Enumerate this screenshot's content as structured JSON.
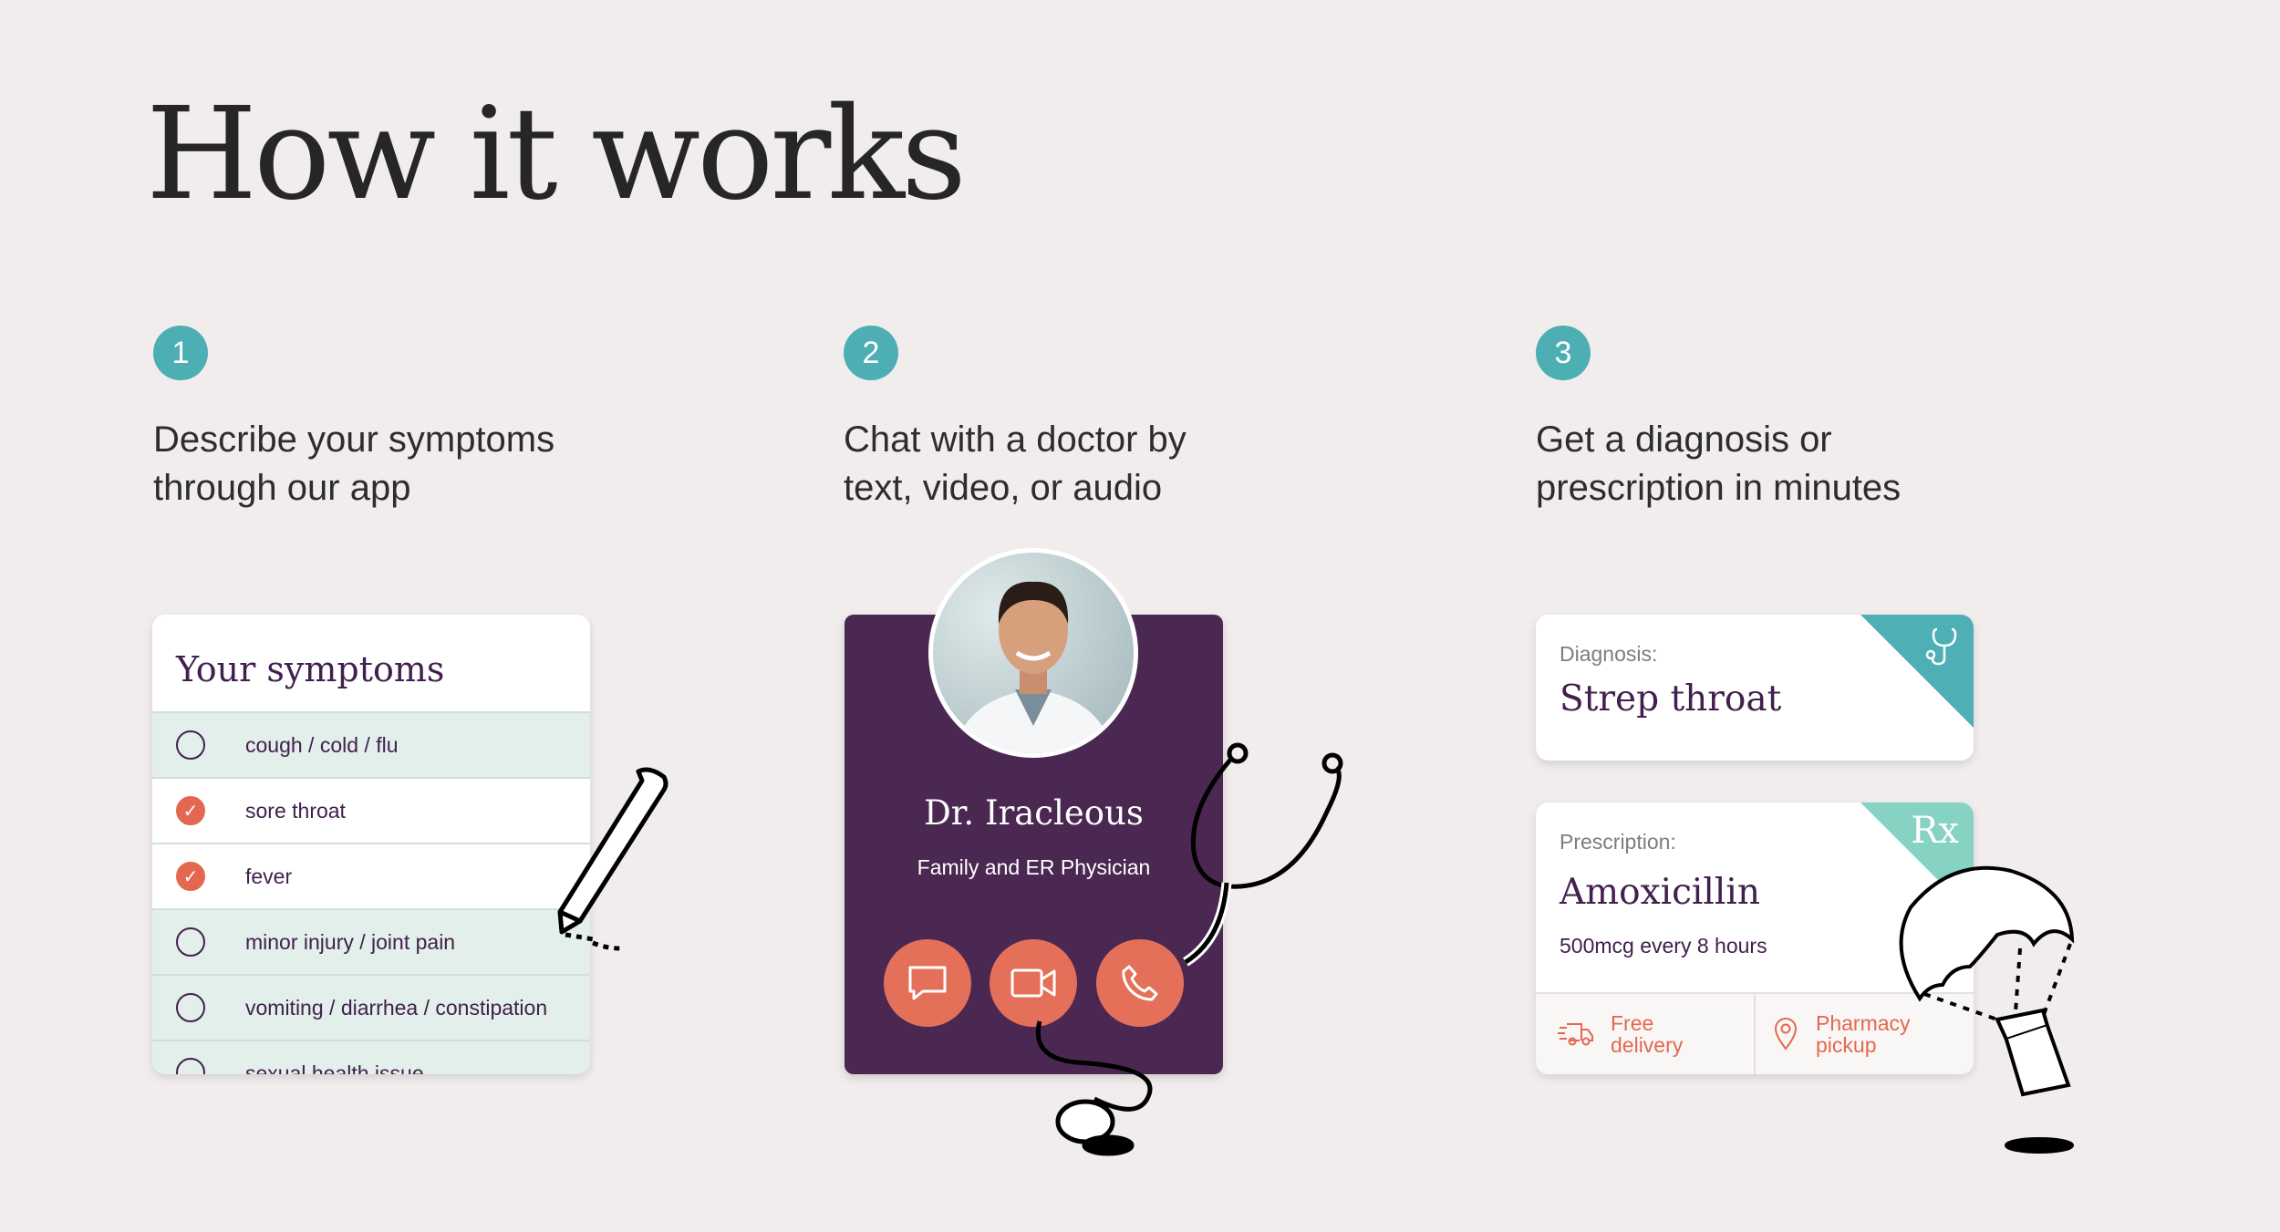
{
  "page": {
    "title": "How it works"
  },
  "steps": [
    {
      "number": "1",
      "line1": "Describe your symptoms",
      "line2": "through our app"
    },
    {
      "number": "2",
      "line1": "Chat with a doctor by",
      "line2": "text, video, or audio"
    },
    {
      "number": "3",
      "line1": "Get a diagnosis or",
      "line2": "prescription in minutes"
    }
  ],
  "symptoms": {
    "title": "Your symptoms",
    "items": [
      {
        "label": "cough / cold / flu",
        "checked": false
      },
      {
        "label": "sore throat",
        "checked": true
      },
      {
        "label": "fever",
        "checked": true
      },
      {
        "label": "minor injury / joint pain",
        "checked": false
      },
      {
        "label": "vomiting / diarrhea / constipation",
        "checked": false
      },
      {
        "label": "sexual health issue",
        "checked": false
      }
    ]
  },
  "doctor": {
    "name": "Dr. Iracleous",
    "role": "Family and ER Physician",
    "actions": [
      "chat-icon",
      "video-icon",
      "phone-icon"
    ]
  },
  "diagnosis": {
    "label": "Diagnosis:",
    "value": "Strep throat",
    "icon": "stethoscope-icon"
  },
  "prescription": {
    "label": "Prescription:",
    "value": "Amoxicillin",
    "dosage": "500mcg every 8 hours",
    "icon": "Rx",
    "options": [
      {
        "line1": "Free",
        "line2": "delivery",
        "icon": "truck-icon"
      },
      {
        "line1": "Pharmacy",
        "line2": "pickup",
        "icon": "location-pin-icon"
      }
    ]
  },
  "colors": {
    "background": "#f2eded",
    "teal": "#4daeb3",
    "mint": "#86d2c3",
    "purple": "#4a2851",
    "coral": "#e4705a"
  }
}
